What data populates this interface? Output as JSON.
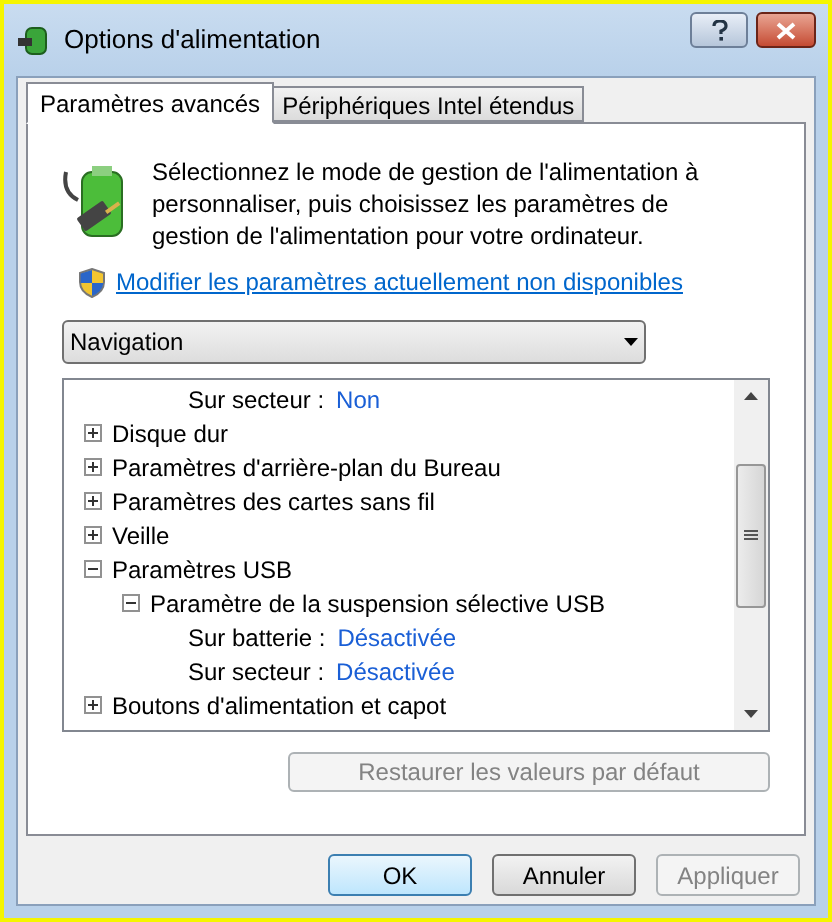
{
  "window": {
    "title": "Options d'alimentation"
  },
  "tabs": [
    {
      "label": "Paramètres avancés",
      "selected": true
    },
    {
      "label": "Périphériques Intel étendus",
      "selected": false
    }
  ],
  "intro": "Sélectionnez le mode de gestion de l'alimentation à personnaliser, puis choisissez les paramètres de gestion de l'alimentation pour votre ordinateur.",
  "link": "Modifier les paramètres actuellement non disponibles",
  "plan_select": {
    "value": "Navigation"
  },
  "tree": [
    {
      "kind": "setting",
      "label": "Sur secteur :",
      "value": "Non"
    },
    {
      "kind": "group",
      "label": "Disque dur",
      "expanded": false
    },
    {
      "kind": "group",
      "label": "Paramètres d'arrière-plan du Bureau",
      "expanded": false
    },
    {
      "kind": "group",
      "label": "Paramètres des cartes sans fil",
      "expanded": false
    },
    {
      "kind": "group",
      "label": "Veille",
      "expanded": false
    },
    {
      "kind": "group",
      "label": "Paramètres USB",
      "expanded": true,
      "children": [
        {
          "kind": "group",
          "label": "Paramètre de la suspension sélective USB",
          "expanded": true,
          "children": [
            {
              "kind": "setting",
              "label": "Sur batterie :",
              "value": "Désactivée"
            },
            {
              "kind": "setting",
              "label": "Sur secteur :",
              "value": "Désactivée"
            }
          ]
        }
      ]
    },
    {
      "kind": "group",
      "label": "Boutons d'alimentation et capot",
      "expanded": false
    }
  ],
  "restore_button": {
    "label": "Restaurer les valeurs par défaut",
    "disabled": true
  },
  "buttons": [
    {
      "label": "OK",
      "kind": "default",
      "disabled": false
    },
    {
      "label": "Annuler",
      "kind": "normal",
      "disabled": false
    },
    {
      "label": "Appliquer",
      "kind": "normal",
      "disabled": true
    }
  ]
}
